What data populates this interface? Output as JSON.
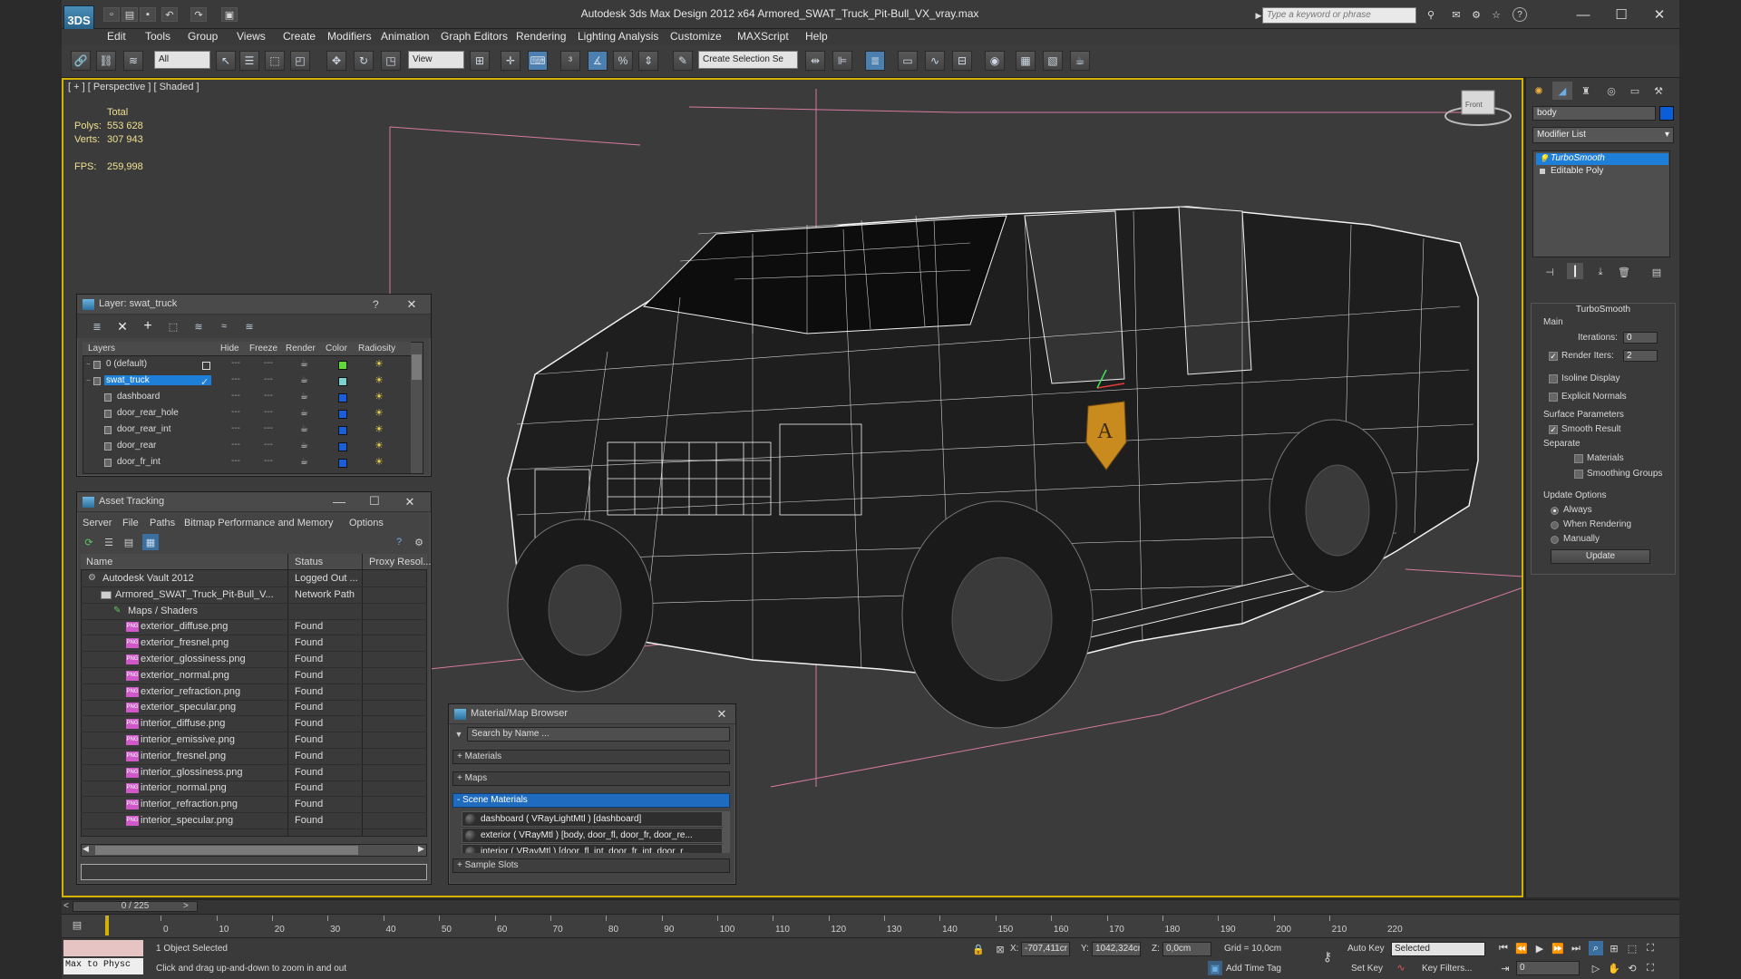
{
  "window": {
    "app_logo": "3DS",
    "title": "Autodesk 3ds Max Design 2012 x64      Armored_SWAT_Truck_Pit-Bull_VX_vray.max",
    "search_placeholder": "Type a keyword or phrase",
    "minimize": "—",
    "maximize": "☐",
    "close": "✕"
  },
  "menu": [
    "Edit",
    "Tools",
    "Group",
    "Views",
    "Create",
    "Modifiers",
    "Animation",
    "Graph Editors",
    "Rendering",
    "Lighting Analysis",
    "Customize",
    "MAXScript",
    "Help"
  ],
  "toolbar": {
    "selection_filter": "All",
    "reference_coord": "View",
    "named_selection": "Create Selection Se"
  },
  "viewport": {
    "label": "[ + ] [ Perspective ] [ Shaded ]",
    "stats": {
      "total_label": "Total",
      "polys_label": "Polys:",
      "polys_value": "553 628",
      "verts_label": "Verts:",
      "verts_value": "307 943",
      "fps_label": "FPS:",
      "fps_value": "259,998"
    },
    "viewcube_label": "Front"
  },
  "command_panel": {
    "object_name": "body",
    "object_color": "#0a5fd8",
    "modifier_list_label": "Modifier List",
    "stack": [
      {
        "label": "TurboSmooth",
        "selected": true
      },
      {
        "label": "Editable Poly",
        "selected": false
      }
    ],
    "turbosmooth": {
      "title": "TurboSmooth",
      "main_label": "Main",
      "iterations_label": "Iterations:",
      "iterations_value": "0",
      "render_iters_label": "Render Iters:",
      "render_iters_value": "2",
      "isoline_label": "Isoline Display",
      "explicit_normals_label": "Explicit Normals",
      "surface_params_label": "Surface Parameters",
      "smooth_result_label": "Smooth Result",
      "separate_label": "Separate",
      "materials_label": "Materials",
      "smoothing_groups_label": "Smoothing Groups",
      "update_options_label": "Update Options",
      "always_label": "Always",
      "when_rendering_label": "When Rendering",
      "manually_label": "Manually",
      "update_button": "Update"
    }
  },
  "layer_window": {
    "title": "Layer: swat_truck",
    "help": "?",
    "close": "✕",
    "columns": [
      "Layers",
      "Hide",
      "Freeze",
      "Render",
      "Color",
      "Radiosity"
    ],
    "rows": [
      {
        "name": "0 (default)",
        "color": "#5fd83a",
        "level": 0,
        "active": false,
        "selected": false
      },
      {
        "name": "swat_truck",
        "color": "#7fd0d0",
        "level": 0,
        "active": true,
        "selected": true
      },
      {
        "name": "dashboard",
        "color": "#1a5fd8",
        "level": 1,
        "active": false,
        "selected": false
      },
      {
        "name": "door_rear_hole",
        "color": "#1a5fd8",
        "level": 1,
        "active": false,
        "selected": false
      },
      {
        "name": "door_rear_int",
        "color": "#1a5fd8",
        "level": 1,
        "active": false,
        "selected": false
      },
      {
        "name": "door_rear",
        "color": "#1a5fd8",
        "level": 1,
        "active": false,
        "selected": false
      },
      {
        "name": "door_fr_int",
        "color": "#1a5fd8",
        "level": 1,
        "active": false,
        "selected": false
      }
    ]
  },
  "asset_window": {
    "title": "Asset Tracking",
    "menus": [
      "Server",
      "File",
      "Paths",
      "Bitmap Performance and Memory",
      "Options"
    ],
    "columns": [
      "Name",
      "Status",
      "Proxy Resol..."
    ],
    "rows": [
      {
        "name": "Autodesk Vault 2012",
        "status": "Logged Out ...",
        "level": 0,
        "kind": "vault"
      },
      {
        "name": "Armored_SWAT_Truck_Pit-Bull_V...",
        "status": "Network Path",
        "level": 1,
        "kind": "file"
      },
      {
        "name": "Maps / Shaders",
        "status": "",
        "level": 2,
        "kind": "folder"
      },
      {
        "name": "exterior_diffuse.png",
        "status": "Found",
        "level": 3,
        "kind": "png"
      },
      {
        "name": "exterior_fresnel.png",
        "status": "Found",
        "level": 3,
        "kind": "png"
      },
      {
        "name": "exterior_glossiness.png",
        "status": "Found",
        "level": 3,
        "kind": "png"
      },
      {
        "name": "exterior_normal.png",
        "status": "Found",
        "level": 3,
        "kind": "png"
      },
      {
        "name": "exterior_refraction.png",
        "status": "Found",
        "level": 3,
        "kind": "png"
      },
      {
        "name": "exterior_specular.png",
        "status": "Found",
        "level": 3,
        "kind": "png"
      },
      {
        "name": "interior_diffuse.png",
        "status": "Found",
        "level": 3,
        "kind": "png"
      },
      {
        "name": "interior_emissive.png",
        "status": "Found",
        "level": 3,
        "kind": "png"
      },
      {
        "name": "interior_fresnel.png",
        "status": "Found",
        "level": 3,
        "kind": "png"
      },
      {
        "name": "interior_glossiness.png",
        "status": "Found",
        "level": 3,
        "kind": "png"
      },
      {
        "name": "interior_normal.png",
        "status": "Found",
        "level": 3,
        "kind": "png"
      },
      {
        "name": "interior_refraction.png",
        "status": "Found",
        "level": 3,
        "kind": "png"
      },
      {
        "name": "interior_specular.png",
        "status": "Found",
        "level": 3,
        "kind": "png"
      }
    ],
    "png_badge": "PNG",
    "scroll_left": "◀",
    "scroll_right": "▶"
  },
  "material_browser": {
    "title": "Material/Map Browser",
    "close": "✕",
    "search_placeholder": "Search by Name ...",
    "groups": [
      "+ Materials",
      "+ Maps",
      "- Scene Materials"
    ],
    "scene_materials": [
      "dashboard ( VRayLightMtl ) [dashboard]",
      "exterior ( VRayMtl ) [body, door_fl, door_fr, door_re...",
      "interior ( VRayMtl ) [door_fl_int, door_fr_int, door_r..."
    ],
    "sample_slots": "+ Sample Slots"
  },
  "timeline": {
    "frame_display": "0 / 225",
    "prev": "<",
    "next": ">",
    "ticks": [
      "0",
      "10",
      "20",
      "30",
      "40",
      "50",
      "60",
      "70",
      "80",
      "90",
      "100",
      "110",
      "120",
      "130",
      "140",
      "150",
      "160",
      "170",
      "180",
      "190",
      "200",
      "210",
      "220"
    ]
  },
  "status": {
    "maxscript_mini": "Max to Physc",
    "selection_status": "1 Object Selected",
    "prompt": "Click and drag up-and-down to zoom in and out",
    "x_label": "X:",
    "x_value": "-707,411cr",
    "y_label": "Y:",
    "y_value": "1042,324cr",
    "z_label": "Z:",
    "z_value": "0,0cm",
    "grid": "Grid = 10,0cm",
    "add_time_tag": "Add Time Tag",
    "auto_key": "Auto Key",
    "set_key": "Set Key",
    "key_mode": "Selected",
    "key_filters": "Key Filters...",
    "current_frame": "0"
  }
}
